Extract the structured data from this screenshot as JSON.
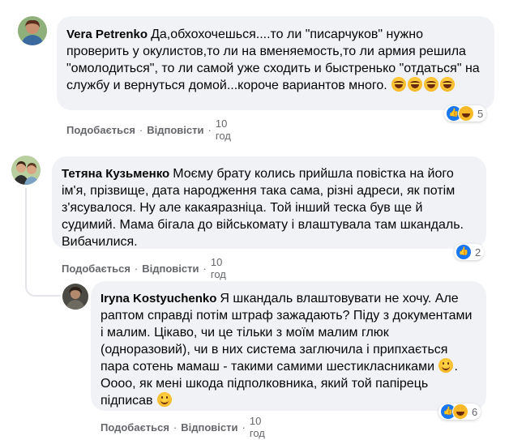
{
  "comments": [
    {
      "author": "Vera Petrenko",
      "text": "Да,обхохочешься....то ли \"писарчуков\" нужно проверить у окулистов,то ли на вменяемость,то ли армия решила \"омолодиться\", то ли самой уже сходить и быстренько \"отдаться\" на службу и вернуться домой...короче вариантов много.",
      "like_label": "Подобається",
      "reply_label": "Відповісти",
      "time": "10 год",
      "reaction_count": "5"
    },
    {
      "author": "Тетяна Кузьменко",
      "text": "Моєму брату колись прийшла повістка на його ім'я, прізвище, дата народження така сама, різні адреси, як потім з'ясувалося. Ну але какаяразніца. Той інший теска був ще й судимий. Мама бігала до військомату і влаштувала там шкандаль. Вибачилися.",
      "like_label": "Подобається",
      "reply_label": "Відповісти",
      "time": "10 год",
      "reaction_count": "2"
    },
    {
      "author": "Iryna Kostyuchenko",
      "text_part1": "Я шкандаль влаштовувати не хочу. Але раптом справді потім штраф зажадають? Піду з документами і малим. Цікаво, чи це тільки з моїм малим глюк (одноразовий), чи в них система заглючила і припхається пара сотень мамаш - такими самими шестикласниками",
      "text_part2": ". Оооо, як мені шкода підполковника, який той папірець підписав",
      "like_label": "Подобається",
      "reply_label": "Відповісти",
      "time": "10 год",
      "reaction_count": "6"
    }
  ],
  "separator": "·",
  "colors": {
    "bubble": "#f0f2f5",
    "meta_text": "#65676b",
    "like_blue": "#1877f2",
    "haha_yellow": "#f7b928"
  }
}
